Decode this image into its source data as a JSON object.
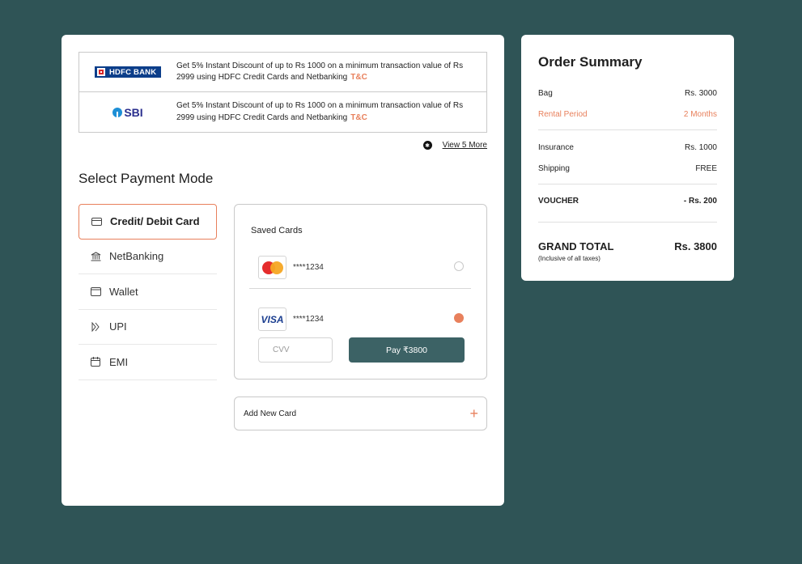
{
  "offers": [
    {
      "bank": "HDFC BANK",
      "text": "Get 5% Instant Discount of up to Rs 1000 on a minimum transaction value of Rs 2999 using HDFC Credit Cards and Netbanking",
      "tc": "T&C"
    },
    {
      "bank": "SBI",
      "text": "Get 5% Instant Discount of up to Rs 1000 on a minimum transaction value of Rs 2999 using HDFC Credit Cards and Netbanking",
      "tc": "T&C"
    }
  ],
  "view_more": "View 5 More",
  "payment": {
    "title": "Select Payment Mode",
    "modes": [
      {
        "label": "Credit/ Debit Card",
        "icon": "card-icon",
        "active": true
      },
      {
        "label": "NetBanking",
        "icon": "bank-icon"
      },
      {
        "label": "Wallet",
        "icon": "wallet-icon"
      },
      {
        "label": "UPI",
        "icon": "upi-icon"
      },
      {
        "label": "EMI",
        "icon": "calendar-icon"
      }
    ]
  },
  "saved_cards": {
    "title": "Saved Cards",
    "cards": [
      {
        "brand": "mastercard",
        "number": "****1234",
        "selected": false
      },
      {
        "brand": "VISA",
        "number": "****1234",
        "selected": true
      }
    ],
    "cvv_placeholder": "CVV",
    "pay_label": "Pay ₹3800"
  },
  "add_card": {
    "label": "Add New Card",
    "icon": "+"
  },
  "summary": {
    "title": "Order Summary",
    "bag": {
      "label": "Bag",
      "value": "Rs. 3000"
    },
    "rental": {
      "label": "Rental Period",
      "value": "2 Months"
    },
    "insurance": {
      "label": "Insurance",
      "value": "Rs. 1000"
    },
    "shipping": {
      "label": "Shipping",
      "value": "FREE"
    },
    "voucher": {
      "label": "VOUCHER",
      "value": "- Rs. 200"
    },
    "grand_total": {
      "label": "GRAND TOTAL",
      "value": "Rs. 3800",
      "note": "(Inclusive of all taxes)"
    }
  },
  "colors": {
    "background": "#2f5456",
    "accent": "#e8805c",
    "button": "#3c6265"
  }
}
